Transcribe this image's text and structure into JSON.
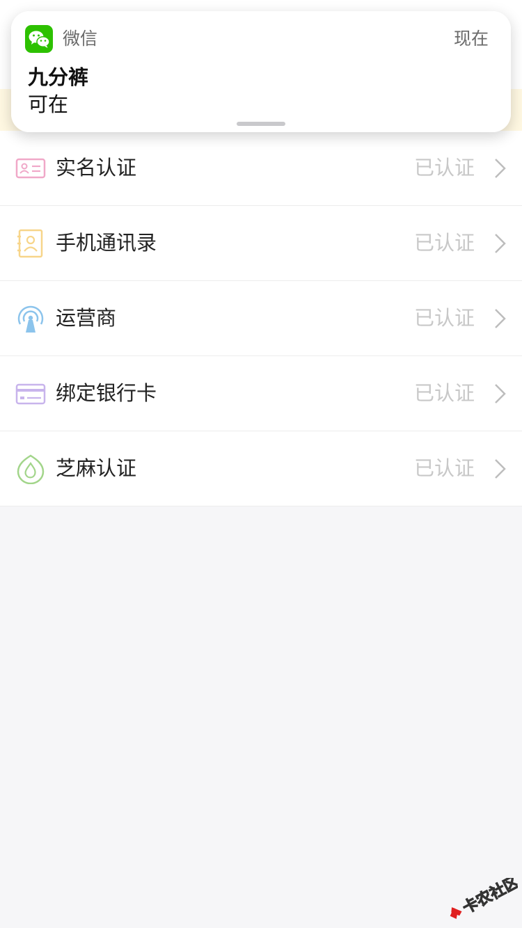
{
  "notification": {
    "app_name": "微信",
    "time": "现在",
    "title": "九分裤",
    "body": "可在"
  },
  "rows": [
    {
      "label": "实名认证",
      "status": "已认证",
      "icon": "id-card-icon"
    },
    {
      "label": "手机通讯录",
      "status": "已认证",
      "icon": "contacts-icon"
    },
    {
      "label": "运营商",
      "status": "已认证",
      "icon": "signal-tower-icon"
    },
    {
      "label": "绑定银行卡",
      "status": "已认证",
      "icon": "bank-card-icon"
    },
    {
      "label": "芝麻认证",
      "status": "已认证",
      "icon": "sesame-icon"
    }
  ],
  "watermark": {
    "text": "卡农社区"
  },
  "colors": {
    "wechat_green": "#2dc100",
    "status_gray": "#c8c8c8",
    "id_icon_pink": "#f0a8c8",
    "contacts_icon_yellow": "#f7d58a",
    "tower_icon_blue": "#8cc4ec",
    "card_icon_purple": "#c8b4ec",
    "sesame_icon_green": "#a2d58a"
  }
}
